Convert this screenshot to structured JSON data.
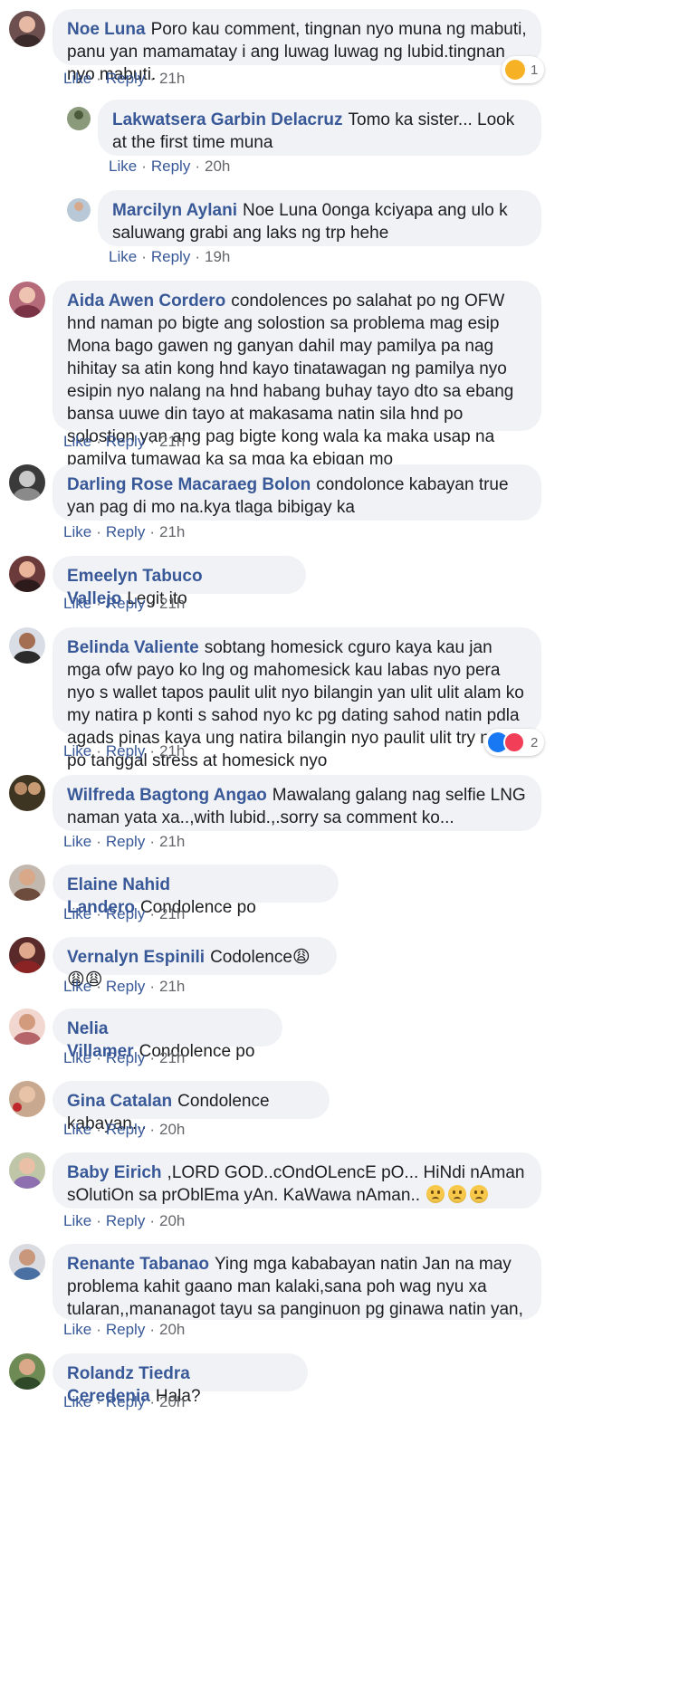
{
  "labels": {
    "like": "Like",
    "reply": "Reply",
    "dot": "·"
  },
  "comments": [
    {
      "author": "Noe Luna",
      "text": "Poro kau comment, tingnan nyo muna ng mabuti, panu yan mamamatay i ang luwag luwag ng lubid.tingnan nyo mabuti.",
      "time": "21h",
      "reaction": {
        "type": "haha",
        "count": "1"
      }
    },
    {
      "author": "Lakwatsera Garbin Delacruz",
      "text": "Tomo ka sister... Look at the first time muna",
      "time": "20h"
    },
    {
      "author": "Marcilyn Aylani",
      "text": "Noe Luna 0onga kciyapa ang ulo k saluwang grabi ang laks ng trp hehe",
      "time": "19h"
    },
    {
      "author": "Aida Awen Cordero",
      "text": "condolences po salahat po ng OFW hnd naman po bigte ang solostion sa problema mag esip Mona bago gawen ng ganyan dahil may pamilya pa nag hihitay sa atin kong hnd kayo tinatawagan ng pamilya nyo esipin nyo nalang na hnd habang buhay tayo dto sa ebang bansa uuwe din tayo at makasama natin sila hnd po solostion yan ang pag bigte kong wala ka maka usap na pamilya tumawag ka sa mga ka ebigan mo",
      "time": "21h"
    },
    {
      "author": "Darling Rose Macaraeg Bolon",
      "text": "condolonce kabayan true yan pag di mo na.kya tlaga bibigay ka",
      "time": "21h"
    },
    {
      "author": "Emeelyn Tabuco Vallejo",
      "text": "Legit ito",
      "time": "21h"
    },
    {
      "author": "Belinda Valiente",
      "text": "sobtang homesick cguro kaya kau jan mga ofw payo ko lng og mahomesick kau labas nyo pera nyo s wallet tapos paulit ulit nyo bilangin yan ulit ulit alam ko my natira p konti s sahod nyo kc pg dating sahod natin pdla agads pinas kaya ung natira bilangin nyo paulit ulit try nyo po tanggal stress at homesick nyo",
      "time": "21h",
      "reaction": {
        "type": "like-love",
        "count": "2"
      }
    },
    {
      "author": "Wilfreda Bagtong Angao",
      "text": "Mawalang galang nag selfie LNG naman yata xa..,with lubid.,.sorry sa comment ko...",
      "time": "21h"
    },
    {
      "author": "Elaine Nahid Landero",
      "text": "Condolence po",
      "time": "21h"
    },
    {
      "author": "Vernalyn Espinili",
      "text": "Codolence😩😩😩",
      "time": "21h"
    },
    {
      "author": "Nelia Villamer",
      "text": "Condolence po",
      "time": "21h"
    },
    {
      "author": "Gina Catalan",
      "text": "Condolence kabayan...",
      "time": "20h"
    },
    {
      "author": "Baby Eirich",
      "text": ",LORD GOD..cOndOLencE pO... HiNdi nAman sOlutiOn sa prOblEma yAn. KaWawa nAman..",
      "time": "20h"
    },
    {
      "author": "Renante Tabanao",
      "text": "Ying mga kababayan natin Jan na may problema kahit gaano man kalaki,sana poh wag nyu xa tularan,,mananagot tayu sa panginuon pg ginawa natin yan,",
      "time": "20h"
    },
    {
      "author": "Rolandz Tiedra Ceredenia",
      "text": "Hala?",
      "time": "20h"
    }
  ],
  "colors": {
    "link": "#385898",
    "bubble": "#f0f2f5",
    "meta": "#65676b"
  }
}
